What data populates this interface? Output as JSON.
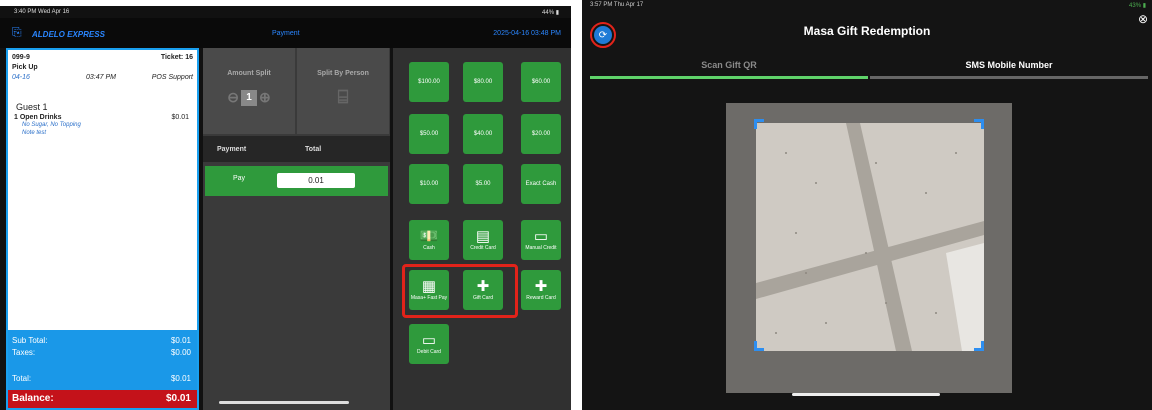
{
  "left_screen": {
    "status_time": "3:40 PM  Wed Apr 16",
    "status_right": "44%",
    "brand": "ALDELO EXPRESS",
    "header_center": "Payment",
    "header_datetime": "2025-04-16 03:48 PM",
    "ticket": {
      "order_no": "099-9",
      "ticket_label": "Ticket: 16",
      "order_type": "Pick Up",
      "date": "04-16",
      "time": "03:47 PM",
      "station": "POS Support",
      "guest": "Guest 1",
      "item_qty_name": "1 Open Drinks",
      "item_price": "$0.01",
      "modifiers": "No Sugar, No Topping",
      "note": "Note test",
      "subtotal_label": "Sub Total:",
      "subtotal_value": "$0.01",
      "taxes_label": "Taxes:",
      "taxes_value": "$0.00",
      "total_label": "Total:",
      "total_value": "$0.01",
      "balance_label": "Balance:",
      "balance_value": "$0.01"
    },
    "split": {
      "amount_split": "Amount Split",
      "split_by_person": "Split By Person",
      "count": "1",
      "payment_header": "Payment",
      "total_header": "Total",
      "pay_label": "Pay",
      "pay_value": "0.01"
    },
    "tenders": {
      "amounts": [
        "$100.00",
        "$80.00",
        "$60.00",
        "$50.00",
        "$40.00",
        "$20.00",
        "$10.00",
        "$5.00"
      ],
      "exact_cash": "Exact Cash",
      "cash": "Cash",
      "credit_card": "Credit Card",
      "manual_credit": "Manual Credit",
      "masa_fast_pay": "Masa+ Fast Pay",
      "gift_card": "Gift Card",
      "reward_card": "Reward Card",
      "debit_card": "Debit Card"
    }
  },
  "right_screen": {
    "status_time": "3:57 PM  Thu Apr 17",
    "status_right": "43%",
    "title": "Masa Gift Redemption",
    "tabs": [
      "Scan Gift QR",
      "SMS Mobile Number"
    ],
    "active_tab_index": 0,
    "accent_color": "#5fd36a"
  },
  "colors": {
    "green_button": "#2f9a3c",
    "highlight_red": "#e2231a",
    "ticket_blue": "#1a98e8",
    "balance_red": "#c4121a"
  }
}
